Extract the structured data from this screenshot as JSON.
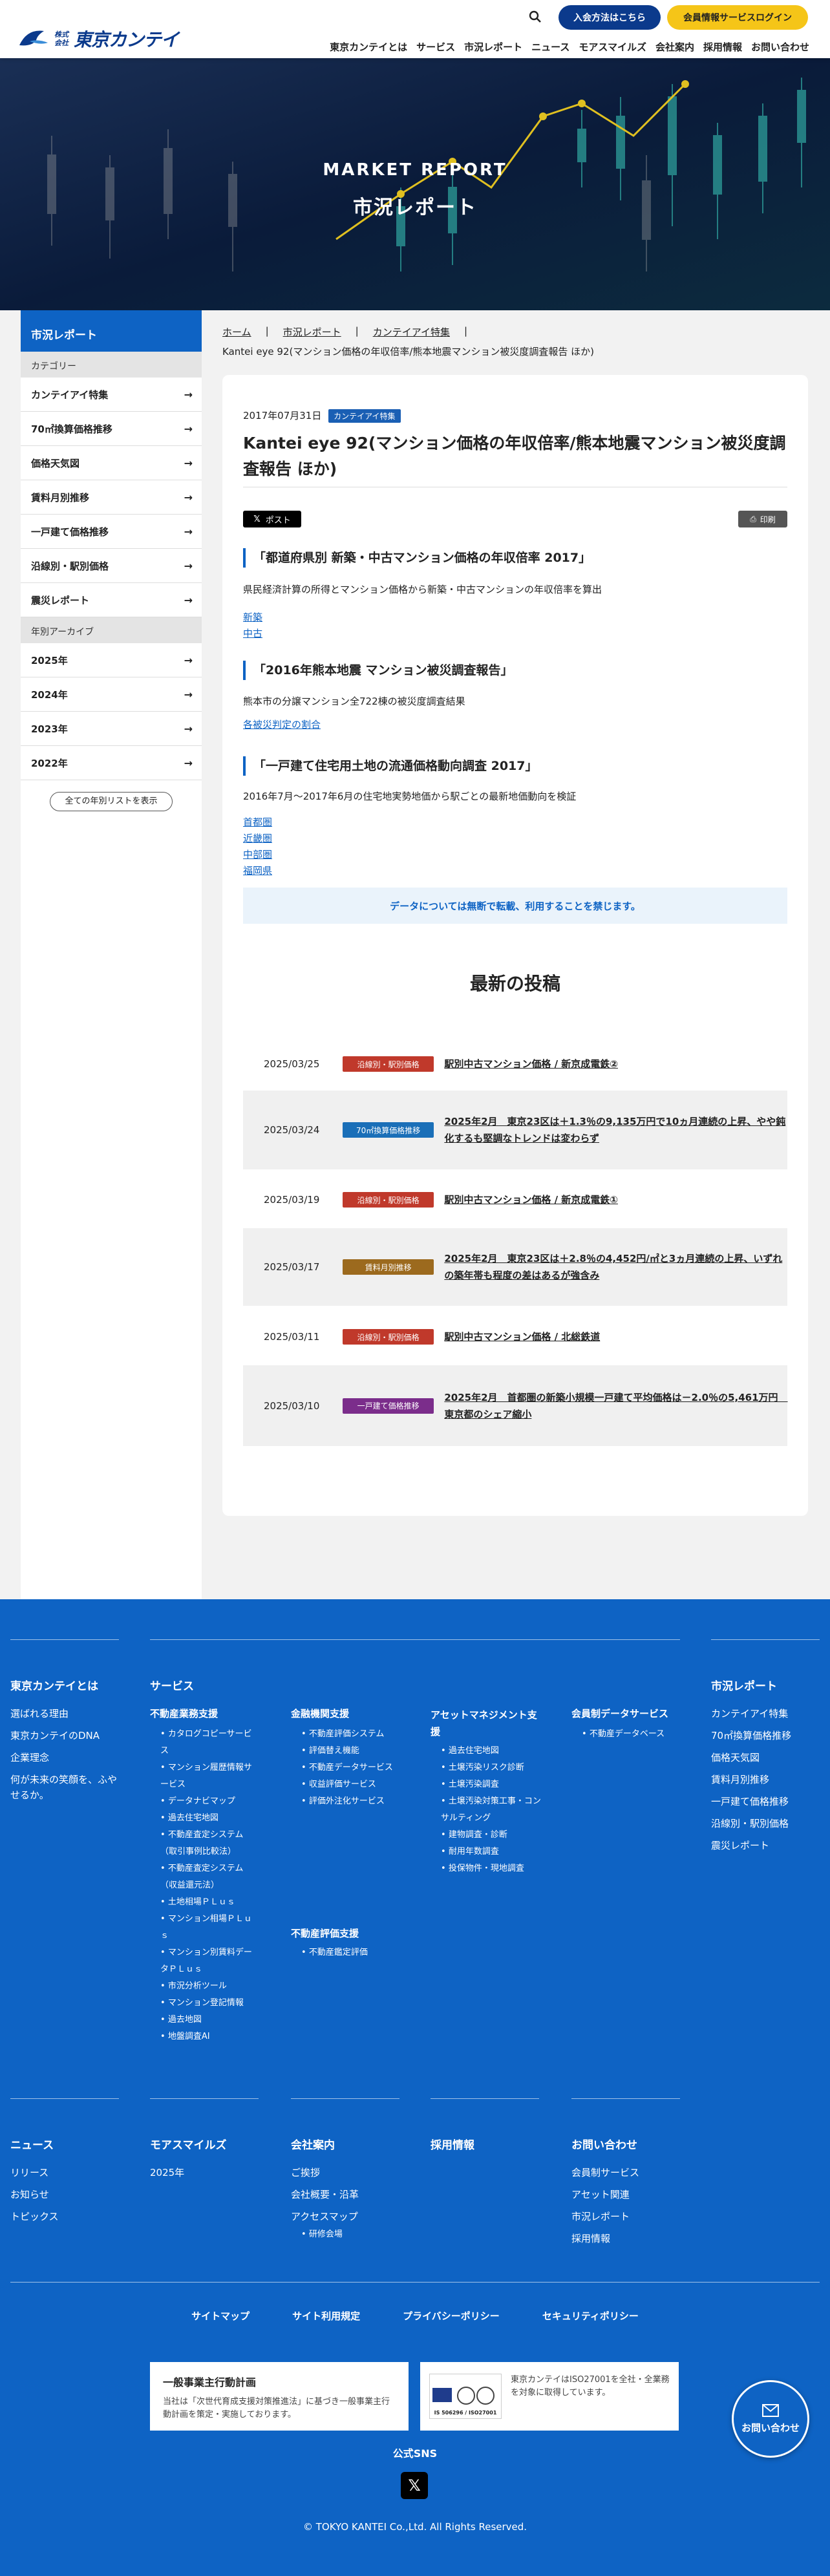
{
  "header": {
    "logo_small": "株式会社",
    "logo_text": "東京カンテイ",
    "btn_entry": "入会方法はこちら",
    "btn_login": "会員情報サービスログイン",
    "nav": [
      "東京カンテイとは",
      "サービス",
      "市況レポート",
      "ニュース",
      "モアスマイルズ",
      "会社案内",
      "採用情報",
      "お問い合わせ"
    ]
  },
  "hero": {
    "sub": "MARKET REPORT",
    "title": "市況レポート"
  },
  "sidebar": {
    "title": "市況レポート",
    "cat_heading": "カテゴリー",
    "categories": [
      "カンテイアイ特集",
      "70㎡換算価格推移",
      "価格天気図",
      "賃料月別推移",
      "一戸建て価格推移",
      "沿線別・駅別価格",
      "震災レポート"
    ],
    "archive_heading": "年別アーカイブ",
    "years": [
      "2025年",
      "2024年",
      "2023年",
      "2022年"
    ],
    "all_years": "全ての年別リストを表示"
  },
  "breadcrumb": {
    "items": [
      "ホーム",
      "市況レポート",
      "カンテイアイ特集"
    ],
    "current": "Kantei eye 92(マンション価格の年収倍率/熊本地震マンション被災度調査報告 ほか)"
  },
  "article": {
    "date": "2017年07月31日",
    "tag": "カンテイアイ特集",
    "title": "Kantei eye 92(マンション価格の年収倍率/熊本地震マンション被災度調査報告 ほか)",
    "post_label": "ポスト",
    "print_label": "印刷",
    "sections": [
      {
        "heading": "「都道府県別 新築・中古マンション価格の年収倍率 2017」",
        "text": "県民経済計算の所得とマンション価格から新築・中古マンションの年収倍率を算出",
        "links": [
          "新築",
          "中古"
        ]
      },
      {
        "heading": "「2016年熊本地震 マンション被災調査報告」",
        "text": "熊本市の分譲マンション全722棟の被災度調査結果",
        "links": [
          "各被災判定の割合"
        ]
      },
      {
        "heading": "「一戸建て住宅用土地の流通価格動向調査 2017」",
        "text": "2016年7月～2017年6月の住宅地実勢地価から駅ごとの最新地価動向を検証",
        "links": [
          "首都圏",
          "近畿圏",
          "中部圏",
          "福岡県"
        ]
      }
    ],
    "notice": "データについては無断で転載、利用することを禁じます。"
  },
  "latest": {
    "heading": "最新の投稿",
    "posts": [
      {
        "date": "2025/03/25",
        "tag": "沿線別・駅別価格",
        "color": "#c0392b",
        "title": "駅別中古マンション価格 / 新京成電鉄②"
      },
      {
        "date": "2025/03/24",
        "tag": "70㎡換算価格推移",
        "color": "#1a6fb8",
        "title": "2025年2月　東京23区は＋1.3％の9,135万円で10ヵ月連続の上昇、やや鈍化するも堅調なトレンドは変わらず"
      },
      {
        "date": "2025/03/19",
        "tag": "沿線別・駅別価格",
        "color": "#c0392b",
        "title": "駅別中古マンション価格 / 新京成電鉄①"
      },
      {
        "date": "2025/03/17",
        "tag": "賃料月別推移",
        "color": "#9c6a1e",
        "title": "2025年2月　東京23区は＋2.8％の4,452円/㎡と3ヵ月連続の上昇、いずれの築年帯も程度の差はあるが強含み"
      },
      {
        "date": "2025/03/11",
        "tag": "沿線別・駅別価格",
        "color": "#c0392b",
        "title": "駅別中古マンション価格 / 北総鉄道"
      },
      {
        "date": "2025/03/10",
        "tag": "一戸建て価格推移",
        "color": "#7b2d8b",
        "title": "2025年2月　首都圏の新築小規模一戸建て平均価格は－2.0％の5,461万円　東京都のシェア縮小"
      }
    ]
  },
  "footer": {
    "about": {
      "heading": "東京カンテイとは",
      "items": [
        "選ばれる理由",
        "東京カンテイのDNA",
        "企業理念",
        "何が未来の笑顔を、ふやせるか。"
      ]
    },
    "service": {
      "heading": "サービス",
      "col1": {
        "heading": "不動産業務支援",
        "items": [
          "カタログコピーサービス",
          "マンション履歴情報サービス",
          "データナビマップ",
          "過去住宅地図",
          "不動産査定システム（取引事例比較法）",
          "不動産査定システム（収益還元法）",
          "土地相場ＰＬｕｓ",
          "マンション相場ＰＬｕｓ",
          "マンション別賃料データＰＬｕｓ",
          "市況分析ツール",
          "マンション登記情報",
          "過去地図",
          "地盤調査AI"
        ]
      },
      "col2": {
        "heading": "金融機関支援",
        "items": [
          "不動産評価システム",
          "評価替え機能",
          "不動産データサービス",
          "収益評価サービス",
          "評価外注化サービス"
        ]
      },
      "col2b": {
        "heading": "不動産評価支援",
        "items": [
          "不動産鑑定評価"
        ]
      },
      "col3": {
        "heading": "アセットマネジメント支援",
        "items": [
          "過去住宅地図",
          "土壌汚染リスク診断",
          "土壌汚染調査",
          "土壌汚染対策工事・コンサルティング",
          "建物調査・診断",
          "耐用年数調査",
          "投保物件・現地調査"
        ]
      },
      "col4": {
        "heading": "会員制データサービス",
        "items": [
          "不動産データベース"
        ]
      }
    },
    "market": {
      "heading": "市況レポート",
      "items": [
        "カンテイアイ特集",
        "70㎡換算価格推移",
        "価格天気図",
        "賃料月別推移",
        "一戸建て価格推移",
        "沿線別・駅別価格",
        "震災レポート"
      ]
    },
    "news": {
      "heading": "ニュース",
      "items": [
        "リリース",
        "お知らせ",
        "トピックス"
      ]
    },
    "moresmiles": {
      "heading": "モアスマイルズ",
      "items": [
        "2025年"
      ]
    },
    "company": {
      "heading": "会社案内",
      "items": [
        "ご挨拶",
        "会社概要・沿革",
        "アクセスマップ"
      ],
      "sub": [
        "研修会場"
      ]
    },
    "recruit": {
      "heading": "採用情報"
    },
    "contact": {
      "heading": "お問い合わせ",
      "items": [
        "会員制サービス",
        "アセット関連",
        "市況レポート",
        "採用情報"
      ]
    },
    "bottom_links": [
      "サイトマップ",
      "サイト利用規定",
      "プライバシーポリシー",
      "セキュリティポリシー"
    ],
    "cert1": {
      "title": "一般事業主行動計画",
      "text": "当社は「次世代育成支援対策推進法」に基づき一般事業主行動計画を策定・実施しております。"
    },
    "cert2": {
      "badge": "IS 506296 / ISO27001",
      "text": "東京カンテイはISO27001を全社・全業務を対象に取得しています。"
    },
    "sns": "公式SNS",
    "copyright": "© TOKYO KANTEI Co.,Ltd. All Rights Reserved.",
    "fab": "お問い合わせ"
  }
}
